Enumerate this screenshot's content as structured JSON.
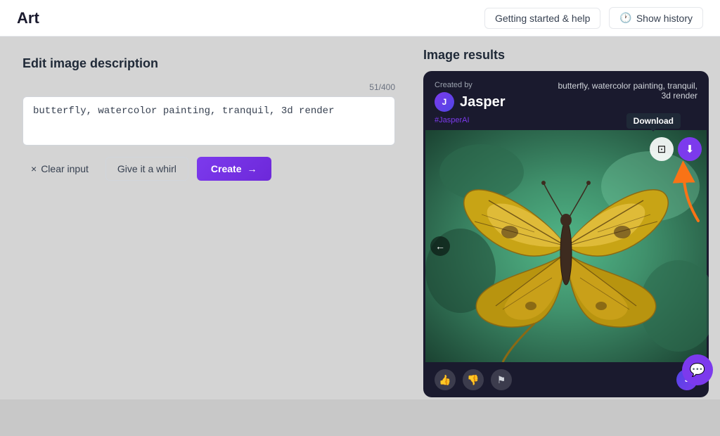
{
  "nav": {
    "logo": "Art",
    "getting_started_label": "Getting started & help",
    "show_history_label": "Show history"
  },
  "left": {
    "section_title": "Edit image description",
    "input_value": "butterfly, watercolor painting, tranquil, 3d render",
    "char_count": "51/400",
    "clear_label": "Clear input",
    "whirl_label": "Give it a whirl",
    "create_label": "Create"
  },
  "right": {
    "section_title": "Image results",
    "card": {
      "created_by_label": "Created by",
      "creator_name": "Jasper",
      "hashtag": "#JasperAI",
      "image_description": "butterfly, watercolor painting, tranquil, 3d render",
      "download_tooltip": "Download"
    }
  },
  "icons": {
    "close": "×",
    "arrow_right": "→",
    "clock": "🕐",
    "download": "⬇",
    "copy": "⧉",
    "back": "←",
    "thumbsup": "👍",
    "thumbsdown": "👎",
    "flag": "⚑",
    "chat": "💬"
  }
}
